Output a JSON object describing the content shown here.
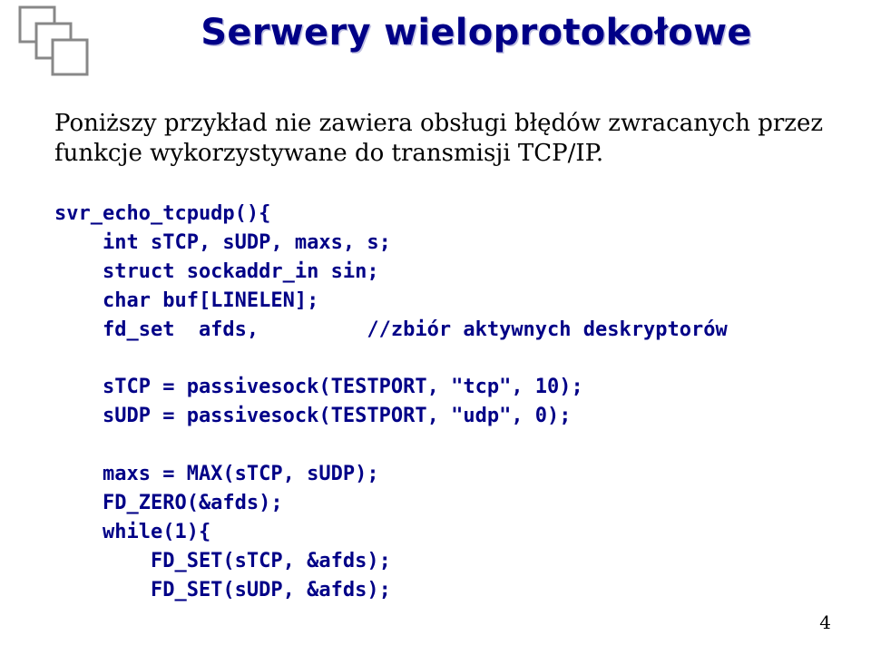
{
  "title": "Serwery wieloprotokołowe",
  "paragraph": "Poniższy przykład nie zawiera obsługi błędów zwracanych przez funkcje wykorzystywane do transmisji TCP/IP.",
  "code": "svr_echo_tcpudp(){\n    int sTCP, sUDP, maxs, s;\n    struct sockaddr_in sin;\n    char buf[LINELEN];\n    fd_set  afds,         //zbiór aktywnych deskryptorów\n\n    sTCP = passivesock(TESTPORT, \"tcp\", 10);\n    sUDP = passivesock(TESTPORT, \"udp\", 0);\n\n    maxs = MAX(sTCP, sUDP);\n    FD_ZERO(&afds);\n    while(1){\n        FD_SET(sTCP, &afds);\n        FD_SET(sUDP, &afds);",
  "page_number": "4",
  "colors": {
    "title": "#000087",
    "code": "#000087",
    "text": "#000000",
    "logo_stroke": "#888888"
  }
}
